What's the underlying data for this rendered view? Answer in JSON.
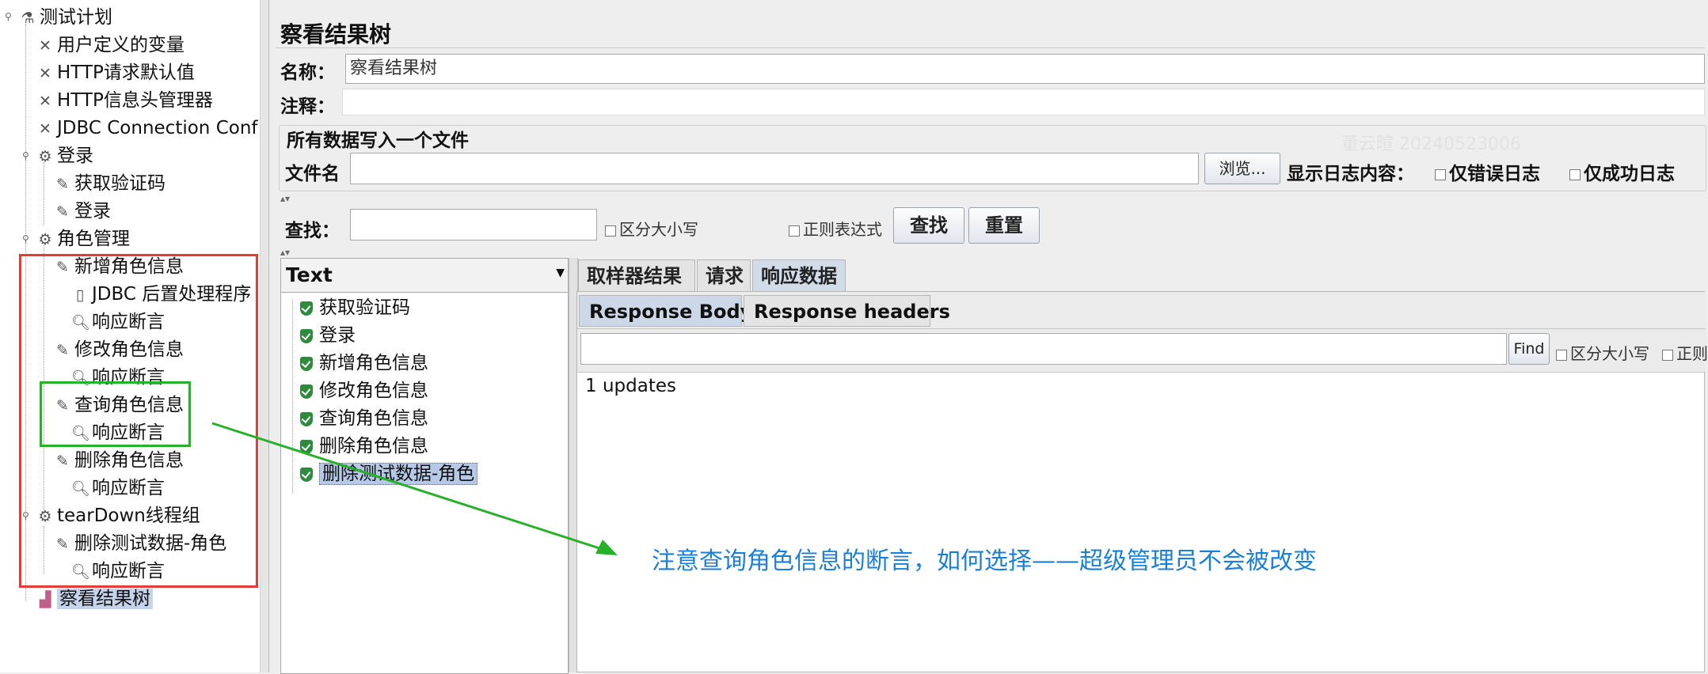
{
  "tree": {
    "nodes": [
      {
        "label": "测试计划",
        "icon": "flask-icon"
      },
      {
        "label": "用户定义的变量",
        "icon": "wrench-icon"
      },
      {
        "label": "HTTP请求默认值",
        "icon": "wrench-icon"
      },
      {
        "label": "HTTP信息头管理器",
        "icon": "wrench-icon"
      },
      {
        "label": "JDBC Connection Conf",
        "icon": "wrench-icon"
      },
      {
        "label": "登录",
        "icon": "gear-icon"
      },
      {
        "label": "获取验证码",
        "icon": "pipette-icon"
      },
      {
        "label": "登录",
        "icon": "pipette-icon"
      },
      {
        "label": "角色管理",
        "icon": "gear-icon"
      },
      {
        "label": "新增角色信息",
        "icon": "pipette-icon"
      },
      {
        "label": "JDBC 后置处理程序",
        "icon": "document-icon"
      },
      {
        "label": "响应断言",
        "icon": "magnifier-icon"
      },
      {
        "label": "修改角色信息",
        "icon": "pipette-icon"
      },
      {
        "label": "响应断言",
        "icon": "magnifier-icon"
      },
      {
        "label": "查询角色信息",
        "icon": "pipette-icon"
      },
      {
        "label": "响应断言",
        "icon": "magnifier-icon"
      },
      {
        "label": "删除角色信息",
        "icon": "pipette-icon"
      },
      {
        "label": "响应断言",
        "icon": "magnifier-icon"
      },
      {
        "label": "tearDown线程组",
        "icon": "gear-icon"
      },
      {
        "label": "删除测试数据-角色",
        "icon": "pipette-icon"
      },
      {
        "label": "响应断言",
        "icon": "magnifier-icon"
      },
      {
        "label": "察看结果树",
        "icon": "chart-icon",
        "selected": true
      }
    ]
  },
  "panel": {
    "title": "察看结果树",
    "name_label": "名称：",
    "name_value": "察看结果树",
    "comment_label": "注释：",
    "comment_value": "",
    "file_section_title": "所有数据写入一个文件",
    "filename_label": "文件名",
    "filename_value": "",
    "browse_button": "浏览...",
    "log_content_label": "显示日志内容：",
    "errors_only_label": "仅错误日志",
    "success_only_label": "仅成功日志",
    "watermark": "董云暄 20240523006"
  },
  "search": {
    "label": "查找：",
    "value": "",
    "case_label": "区分大小写",
    "regex_label": "正则表达式",
    "find_button": "查找",
    "reset_button": "重置"
  },
  "results": {
    "renderer": "Text",
    "items": [
      {
        "label": "获取验证码"
      },
      {
        "label": "登录"
      },
      {
        "label": "新增角色信息"
      },
      {
        "label": "修改角色信息"
      },
      {
        "label": "查询角色信息"
      },
      {
        "label": "删除角色信息"
      },
      {
        "label": "删除测试数据-角色",
        "selected": true
      }
    ]
  },
  "detail": {
    "tabs": [
      "取样器结果",
      "请求",
      "响应数据"
    ],
    "active_tab": "响应数据",
    "subtabs": [
      "Response Body",
      "Response headers"
    ],
    "active_subtab": "Response Body",
    "find_value": "",
    "find_button": "Find",
    "case_label": "区分大小写",
    "regex_label": "正则",
    "body_text": "1 updates"
  },
  "annotation": {
    "note": "注意查询角色信息的断言，如何选择——超级管理员不会被改变",
    "red_color": "#e53a35",
    "green_color": "#27b02a",
    "note_color": "#1a7fd8"
  }
}
